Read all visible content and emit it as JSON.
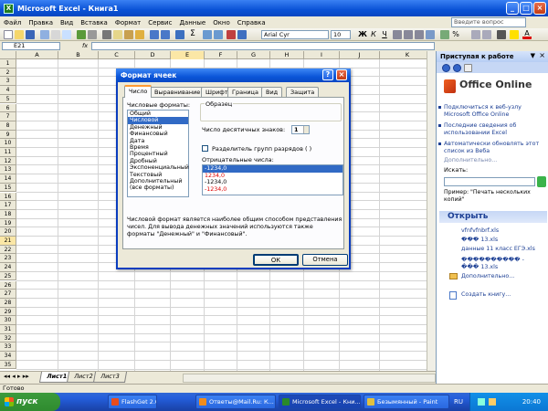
{
  "window": {
    "title": "Microsoft Excel - Книга1"
  },
  "menu": [
    "Файл",
    "Правка",
    "Вид",
    "Вставка",
    "Формат",
    "Сервис",
    "Данные",
    "Окно",
    "Справка"
  ],
  "help_placeholder": "Введите вопрос",
  "toolbar": {
    "font": "Arial Cyr",
    "size": "10"
  },
  "formula_bar": {
    "name_box": "E21",
    "fx": "fx"
  },
  "columns": [
    "A",
    "B",
    "C",
    "D",
    "E",
    "F",
    "G",
    "H",
    "I",
    "J",
    "K"
  ],
  "rows": [
    "1",
    "2",
    "3",
    "4",
    "5",
    "6",
    "7",
    "8",
    "9",
    "10",
    "11",
    "12",
    "13",
    "14",
    "15",
    "16",
    "17",
    "18",
    "19",
    "20",
    "21",
    "22",
    "23",
    "24",
    "25",
    "26",
    "27",
    "28",
    "29",
    "30",
    "31",
    "32",
    "33",
    "34",
    "35"
  ],
  "sheets": [
    "Лист1",
    "Лист2",
    "Лист3"
  ],
  "status": "Готово",
  "taskbar": {
    "start": "пуск",
    "tasks": [
      "FlashGet 2.0",
      "Ответы@Mail.Ru: К...",
      "Microsoft Excel - Кни...",
      "Безымянный - Paint"
    ],
    "lang": "RU",
    "time": "20:40"
  },
  "taskpane": {
    "title": "Приступая к работе",
    "logo": "Office Online",
    "links": [
      "Подключиться к веб-узлу Microsoft Office Online",
      "Последние сведения об использовании Excel",
      "Автоматически обновлять этот список из Веба"
    ],
    "more1": "Дополнительно...",
    "search_label": "Искать:",
    "example": "Пример: \"Печать нескольких копий\"",
    "open_header": "Открыть",
    "files": [
      "vfnfvfnbrf.xls",
      "��� 13.xls",
      "данные 11 класс ЕГЭ.xls",
      "���������� - ��� 13.xls"
    ],
    "more2": "Дополнительно...",
    "create": "Создать книгу..."
  },
  "dialog": {
    "title": "Формат ячеек",
    "tabs": [
      "Число",
      "Выравнивание",
      "Шрифт",
      "Граница",
      "Вид",
      "Защита"
    ],
    "formats_label": "Числовые форматы:",
    "formats": [
      "Общий",
      "Числовой",
      "Денежный",
      "Финансовый",
      "Дата",
      "Время",
      "Процентный",
      "Дробный",
      "Экспоненциальный",
      "Текстовый",
      "Дополнительный",
      "(все форматы)"
    ],
    "sample_label": "Образец",
    "decimals_label": "Число десятичных знаков:",
    "decimals_value": "1",
    "separator_label": "Разделитель групп разрядов ( )",
    "negative_label": "Отрицательные числа:",
    "negatives": [
      "-1234,0",
      "1234,0",
      "-1234,0",
      "-1234,0"
    ],
    "description": "Числовой формат является наиболее общим способом представления чисел. Для вывода денежных значений используются также форматы \"Денежный\" и \"Финансовый\".",
    "ok": "ОК",
    "cancel": "Отмена"
  }
}
